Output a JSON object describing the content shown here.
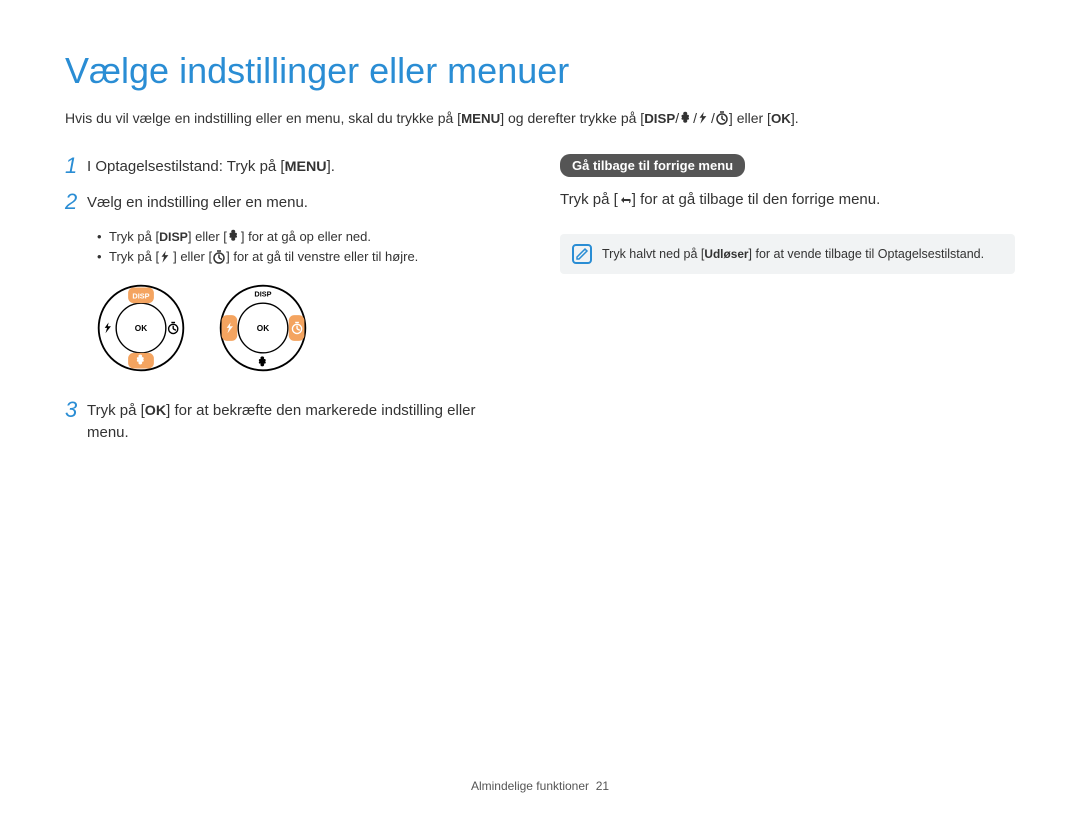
{
  "title": "Vælge indstillinger eller menuer",
  "intro_parts": {
    "a": "Hvis du vil vælge en indstilling eller en menu, skal du trykke på [",
    "menu": "MENU",
    "b": "] og derefter trykke på [",
    "disp": "DISP",
    "c": "/",
    "d": "/",
    "e": "/",
    "f": "] eller [",
    "ok": "OK",
    "g": "]."
  },
  "steps": {
    "s1": {
      "num": "1",
      "text_a": "I Optagelsestilstand: Tryk på [",
      "menu": "MENU",
      "text_b": "]."
    },
    "s2": {
      "num": "2",
      "text": "Vælg en indstilling eller en menu.",
      "bullets": {
        "b1a": "Tryk på [",
        "b1_disp": "DISP",
        "b1b": "] eller [",
        "b1c": "] for at gå op eller ned.",
        "b2a": "Tryk på [",
        "b2b": "] eller [",
        "b2c": "] for at gå til venstre eller til højre."
      }
    },
    "s3": {
      "num": "3",
      "text_a": "Tryk på [",
      "ok": "OK",
      "text_b": "] for at bekræfte den markerede indstilling eller menu."
    }
  },
  "dial": {
    "disp": "DISP",
    "ok": "OK"
  },
  "subheading": "Gå tilbage til forrige menu",
  "right_line": {
    "a": "Tryk på [",
    "b": "] for at gå tilbage til den forrige menu."
  },
  "note": {
    "a": "Tryk halvt ned på [",
    "bold": "Udløser",
    "b": "] for at vende tilbage til Optagelsestilstand."
  },
  "footer": {
    "label": "Almindelige funktioner",
    "page": "21"
  }
}
